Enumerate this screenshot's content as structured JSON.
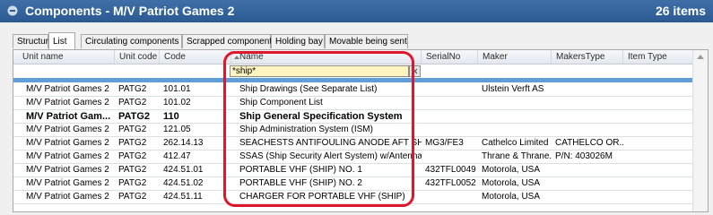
{
  "window": {
    "title": "Components - M/V Patriot Games 2",
    "item_count": "26 items"
  },
  "tabs": [
    {
      "label": "Structure",
      "active": false
    },
    {
      "label": "List",
      "active": true
    },
    {
      "label": "Circulating components",
      "active": false
    },
    {
      "label": "Scrapped components",
      "active": false
    },
    {
      "label": "Holding bay",
      "active": false
    },
    {
      "label": "Movable being sent",
      "active": false
    }
  ],
  "columns": [
    "Unit name",
    "Unit code",
    "Code",
    "Name",
    "SerialNo",
    "Maker",
    "MakersType",
    "Item Type"
  ],
  "filter": {
    "name_value": "*ship*"
  },
  "rows": [
    {
      "unit_name": "M/V Patriot Games 2",
      "unit_code": "PATG2",
      "code": "101.01",
      "name": "Ship Drawings (See Separate List)",
      "serial": "",
      "maker": "Ulstein Verft AS",
      "makers_type": "",
      "item_type": "",
      "bold": false
    },
    {
      "unit_name": "M/V Patriot Games 2",
      "unit_code": "PATG2",
      "code": "101.02",
      "name": "Ship Component List",
      "serial": "",
      "maker": "",
      "makers_type": "",
      "item_type": "",
      "bold": false
    },
    {
      "unit_name": "M/V Patriot Gam...",
      "unit_code": "PATG2",
      "code": "110",
      "name": "Ship General Specification System",
      "serial": "",
      "maker": "",
      "makers_type": "",
      "item_type": "",
      "bold": true
    },
    {
      "unit_name": "M/V Patriot Games 2",
      "unit_code": "PATG2",
      "code": "121.05",
      "name": "Ship Administration System (ISM)",
      "serial": "",
      "maker": "",
      "makers_type": "",
      "item_type": "",
      "bold": false
    },
    {
      "unit_name": "M/V Patriot Games 2",
      "unit_code": "PATG2",
      "code": "262.14.13",
      "name": "SEACHESTS ANTIFOULING ANODE AFT SHIP",
      "serial": "MG3/FE3",
      "maker": "Cathelco Limited",
      "makers_type": "CATHELCO OR...",
      "item_type": "",
      "bold": false
    },
    {
      "unit_name": "M/V Patriot Games 2",
      "unit_code": "PATG2",
      "code": "412.47",
      "name": "SSAS (Ship Security Alert System) w/Antenna, Pos.",
      "serial": "",
      "maker": "Thrane & Thrane...",
      "makers_type": "P/N: 403026M",
      "item_type": "",
      "bold": false
    },
    {
      "unit_name": "M/V Patriot Games 2",
      "unit_code": "PATG2",
      "code": "424.51.01",
      "name": "PORTABLE VHF (SHIP) NO. 1",
      "serial": "432TFL0049",
      "maker": "Motorola, USA",
      "makers_type": "",
      "item_type": "",
      "bold": false
    },
    {
      "unit_name": "M/V Patriot Games 2",
      "unit_code": "PATG2",
      "code": "424.51.02",
      "name": "PORTABLE VHF (SHIP) NO. 2",
      "serial": "432TFL0052",
      "maker": "Motorola, USA",
      "makers_type": "",
      "item_type": "",
      "bold": false
    },
    {
      "unit_name": "M/V Patriot Games 2",
      "unit_code": "PATG2",
      "code": "424.51.11",
      "name": "CHARGER FOR PORTABLE VHF (SHIP)",
      "serial": "",
      "maker": "Motorola, USA",
      "makers_type": "",
      "item_type": "",
      "bold": false
    }
  ],
  "colors": {
    "title_bar": "#2b5a93",
    "filter_bg": "#fff5c0",
    "selection_bar": "#5f9ed8",
    "highlight": "#e0162b"
  }
}
